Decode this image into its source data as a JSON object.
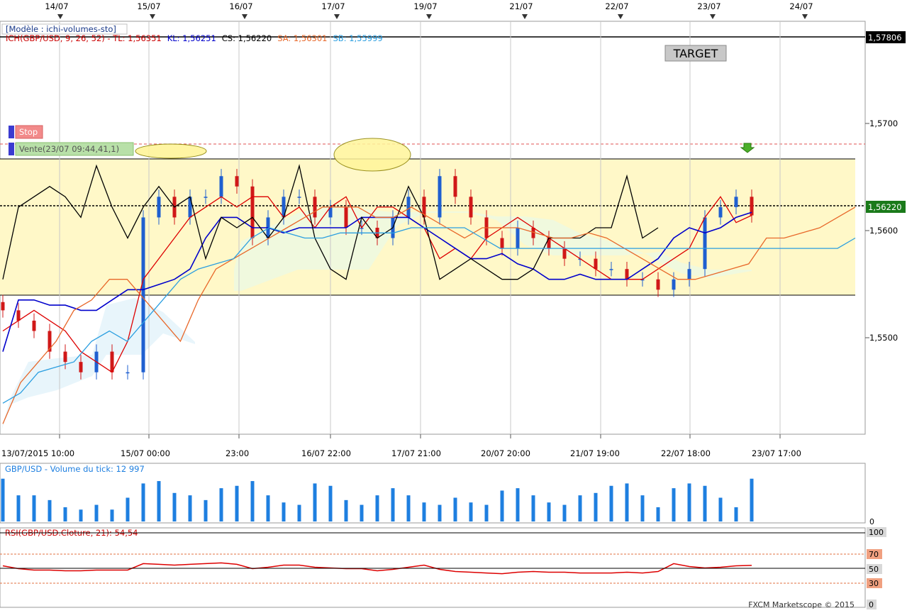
{
  "header": {
    "model_label": "[Modèle : ichi-volumes-sto]",
    "ichimoku": {
      "prefix": "ICH(GBP/USD, 9, 26, 52) - ",
      "tl": "TL: 1,56351",
      "kl": "KL: 1,56251",
      "cs": "CS: 1,56220",
      "sa": "SA: 1,56301",
      "sb": "SB: 1,55999"
    }
  },
  "markers": {
    "target": "TARGET",
    "stop": "Stop",
    "vente": "Vente(23/07 09:44,41,1)"
  },
  "date_axis": [
    "14/07",
    "15/07",
    "16/07",
    "17/07",
    "19/07",
    "21/07",
    "22/07",
    "23/07",
    "24/07"
  ],
  "time_axis": [
    "13/07/2015 10:00",
    "15/07 00:00",
    "23:00",
    "16/07 22:00",
    "17/07 21:00",
    "20/07 20:00",
    "21/07 19:00",
    "22/07 18:00",
    "23/07 17:00"
  ],
  "price_axis": {
    "ticks": [
      "1,5700",
      "1,5600",
      "1,5500"
    ],
    "target_level": "1,57806",
    "current_level": "1,56220"
  },
  "volume_panel": {
    "title": "GBP/USD - Volume du tick: 12 997",
    "zero": "0"
  },
  "rsi_panel": {
    "title": "RSI(GBP/USD.Cloture, 21): 54,54",
    "ticks": [
      "100",
      "70",
      "50",
      "30",
      "0"
    ]
  },
  "footer": {
    "copyright": "FXCM Marketscope © 2015"
  },
  "colors": {
    "tl": "#dd0000",
    "kl": "#0000cc",
    "cs": "#000000",
    "sa": "#e8682a",
    "sb": "#2a9ee0",
    "volume": "#1e7fe0",
    "rsi": "#dd0000",
    "range_fill": "#fff8c8",
    "bull": "#1f5fd0",
    "bear": "#d01818"
  },
  "chart_data": {
    "type": "candlestick",
    "symbol": "GBP/USD",
    "ylim": [
      1.541,
      1.581
    ],
    "range_box": [
      1.554,
      1.5666
    ],
    "target": 1.57806,
    "stop": 1.568,
    "current": 1.5622,
    "series": [
      {
        "name": "TL",
        "values": [
          1.551,
          1.552,
          1.553,
          1.552,
          1.551,
          1.549,
          1.548,
          1.547,
          1.55,
          1.556,
          1.558,
          1.56,
          1.562,
          1.563,
          1.564,
          1.563,
          1.564,
          1.564,
          1.562,
          1.563,
          1.561,
          1.563,
          1.564,
          1.561,
          1.563,
          1.563,
          1.562,
          1.561,
          1.558,
          1.559,
          1.558,
          1.56,
          1.561,
          1.562,
          1.561,
          1.56,
          1.559,
          1.558,
          1.557,
          1.556,
          1.556,
          1.556,
          1.557,
          1.558,
          1.559,
          1.562,
          1.564,
          1.5615,
          1.5622
        ]
      },
      {
        "name": "KL",
        "values": [
          1.549,
          1.554,
          1.554,
          1.5535,
          1.5535,
          1.553,
          1.553,
          1.554,
          1.555,
          1.555,
          1.5555,
          1.556,
          1.557,
          1.56,
          1.562,
          1.562,
          1.561,
          1.561,
          1.5605,
          1.561,
          1.561,
          1.561,
          1.561,
          1.562,
          1.562,
          1.562,
          1.562,
          1.561,
          1.56,
          1.559,
          1.558,
          1.558,
          1.5585,
          1.5575,
          1.557,
          1.556,
          1.556,
          1.5565,
          1.556,
          1.556,
          1.556,
          1.557,
          1.558,
          1.56,
          1.561,
          1.5605,
          1.561,
          1.562,
          1.5625
        ]
      },
      {
        "name": "CS",
        "values": [
          1.556,
          1.563,
          1.564,
          1.565,
          1.564,
          1.562,
          1.567,
          1.563,
          1.56,
          1.563,
          1.565,
          1.563,
          1.564,
          1.558,
          1.562,
          1.561,
          1.562,
          1.56,
          1.562,
          1.567,
          1.56,
          1.557,
          1.556,
          1.562,
          1.56,
          1.561,
          1.565,
          1.562,
          1.556,
          1.557,
          1.558,
          1.557,
          1.556,
          1.556,
          1.557,
          1.56,
          1.56,
          1.56,
          1.561,
          1.561,
          1.566,
          1.56,
          1.561,
          null,
          null,
          null,
          null,
          null,
          null
        ]
      },
      {
        "name": "SA",
        "values": [
          1.542,
          1.546,
          1.548,
          1.55,
          1.553,
          1.554,
          1.556,
          1.556,
          1.554,
          1.552,
          1.55,
          1.554,
          1.557,
          1.558,
          1.559,
          1.56,
          1.561,
          1.562,
          1.563,
          1.563,
          1.563,
          1.562,
          1.562,
          1.563,
          1.562,
          1.561,
          1.56,
          1.561,
          1.561,
          1.561,
          1.5605,
          1.56,
          1.56,
          1.5605,
          1.56,
          1.559,
          1.558,
          1.557,
          1.556,
          1.556,
          1.5565,
          1.557,
          1.5575,
          1.56,
          1.56,
          1.5605,
          1.561,
          1.562,
          1.563
        ]
      },
      {
        "name": "SB",
        "values": [
          1.544,
          1.545,
          1.547,
          1.5475,
          1.548,
          1.55,
          1.551,
          1.55,
          1.552,
          1.554,
          1.556,
          1.557,
          1.5575,
          1.558,
          1.56,
          1.561,
          1.5605,
          1.56,
          1.56,
          1.5605,
          1.5605,
          1.5605,
          1.5605,
          1.561,
          1.561,
          1.561,
          1.561,
          1.56,
          1.559,
          1.559,
          1.559,
          1.559,
          1.559,
          1.559,
          1.559,
          1.559,
          1.559,
          1.559,
          1.559,
          1.559,
          1.559,
          1.559,
          1.559,
          1.559,
          1.559,
          1.559,
          1.559,
          1.559,
          1.56
        ]
      }
    ],
    "candles_close": [
      1.553,
      1.552,
      1.551,
      1.549,
      1.548,
      1.547,
      1.549,
      1.547,
      1.547,
      1.562,
      1.564,
      1.562,
      1.564,
      1.564,
      1.566,
      1.565,
      1.56,
      1.562,
      1.564,
      1.564,
      1.562,
      1.563,
      1.561,
      1.561,
      1.56,
      1.562,
      1.564,
      1.562,
      1.566,
      1.564,
      1.562,
      1.56,
      1.559,
      1.561,
      1.56,
      1.559,
      1.558,
      1.558,
      1.557,
      1.557,
      1.556,
      1.556,
      1.555,
      1.556,
      1.557,
      1.562,
      1.563,
      1.564,
      1.5622
    ],
    "volume": [
      0.9,
      0.55,
      0.55,
      0.45,
      0.3,
      0.25,
      0.35,
      0.25,
      0.5,
      0.8,
      0.85,
      0.6,
      0.55,
      0.45,
      0.7,
      0.75,
      0.85,
      0.55,
      0.4,
      0.35,
      0.8,
      0.75,
      0.45,
      0.35,
      0.55,
      0.7,
      0.55,
      0.4,
      0.35,
      0.5,
      0.4,
      0.35,
      0.65,
      0.7,
      0.55,
      0.4,
      0.35,
      0.55,
      0.6,
      0.75,
      0.8,
      0.55,
      0.3,
      0.7,
      0.8,
      0.75,
      0.5,
      0.3,
      0.9
    ],
    "rsi": [
      54,
      50,
      48,
      48,
      47,
      47,
      48,
      48,
      48,
      57,
      56,
      55,
      56,
      57,
      58,
      56,
      50,
      52,
      55,
      55,
      52,
      51,
      50,
      50,
      47,
      49,
      52,
      55,
      49,
      46,
      45,
      44,
      43,
      45,
      46,
      45,
      45,
      44,
      44,
      44,
      45,
      44,
      46,
      57,
      53,
      51,
      52,
      54,
      54.54
    ]
  }
}
